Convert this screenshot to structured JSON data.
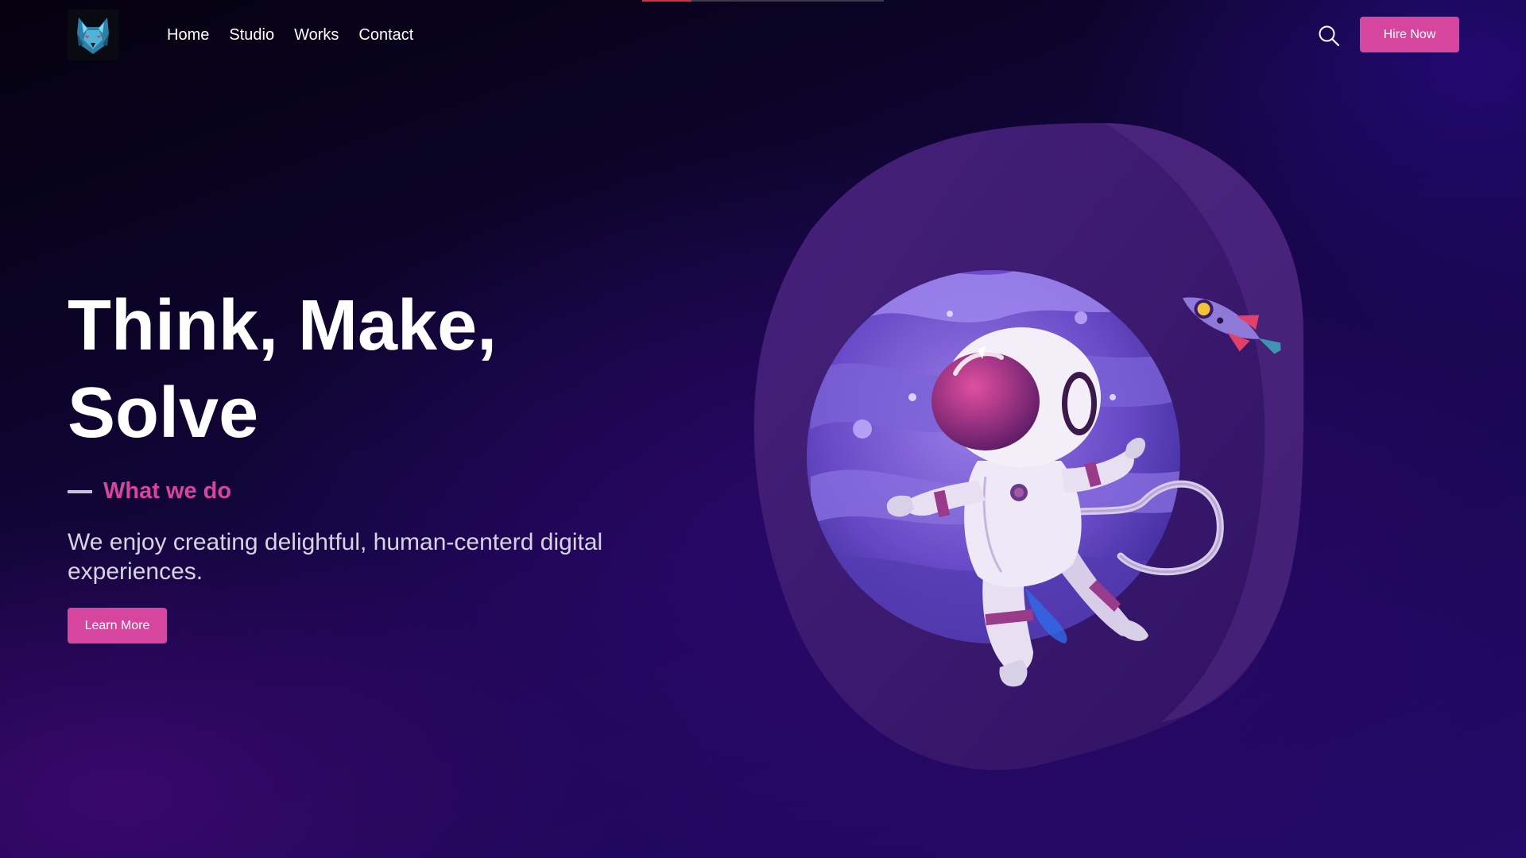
{
  "colors": {
    "accent": "#d6469e",
    "background_dark": "#05010f",
    "background_purple": "#240a6a",
    "blob": "#3e1a6e"
  },
  "header": {
    "logo_icon": "wolf-head-logo",
    "nav": [
      {
        "label": "Home"
      },
      {
        "label": "Studio"
      },
      {
        "label": "Works"
      },
      {
        "label": "Contact"
      }
    ],
    "search_icon": "search-icon",
    "hire_label": "Hire Now"
  },
  "hero": {
    "title_line1": "Think, Make,",
    "title_line2": "Solve",
    "eyebrow": "What we do",
    "lead": "We enjoy creating delightful, human-centerd digital experiences.",
    "cta_label": "Learn More"
  },
  "illustration": {
    "subject": "astronaut-floating-before-planet",
    "extras": [
      "rocket"
    ]
  }
}
